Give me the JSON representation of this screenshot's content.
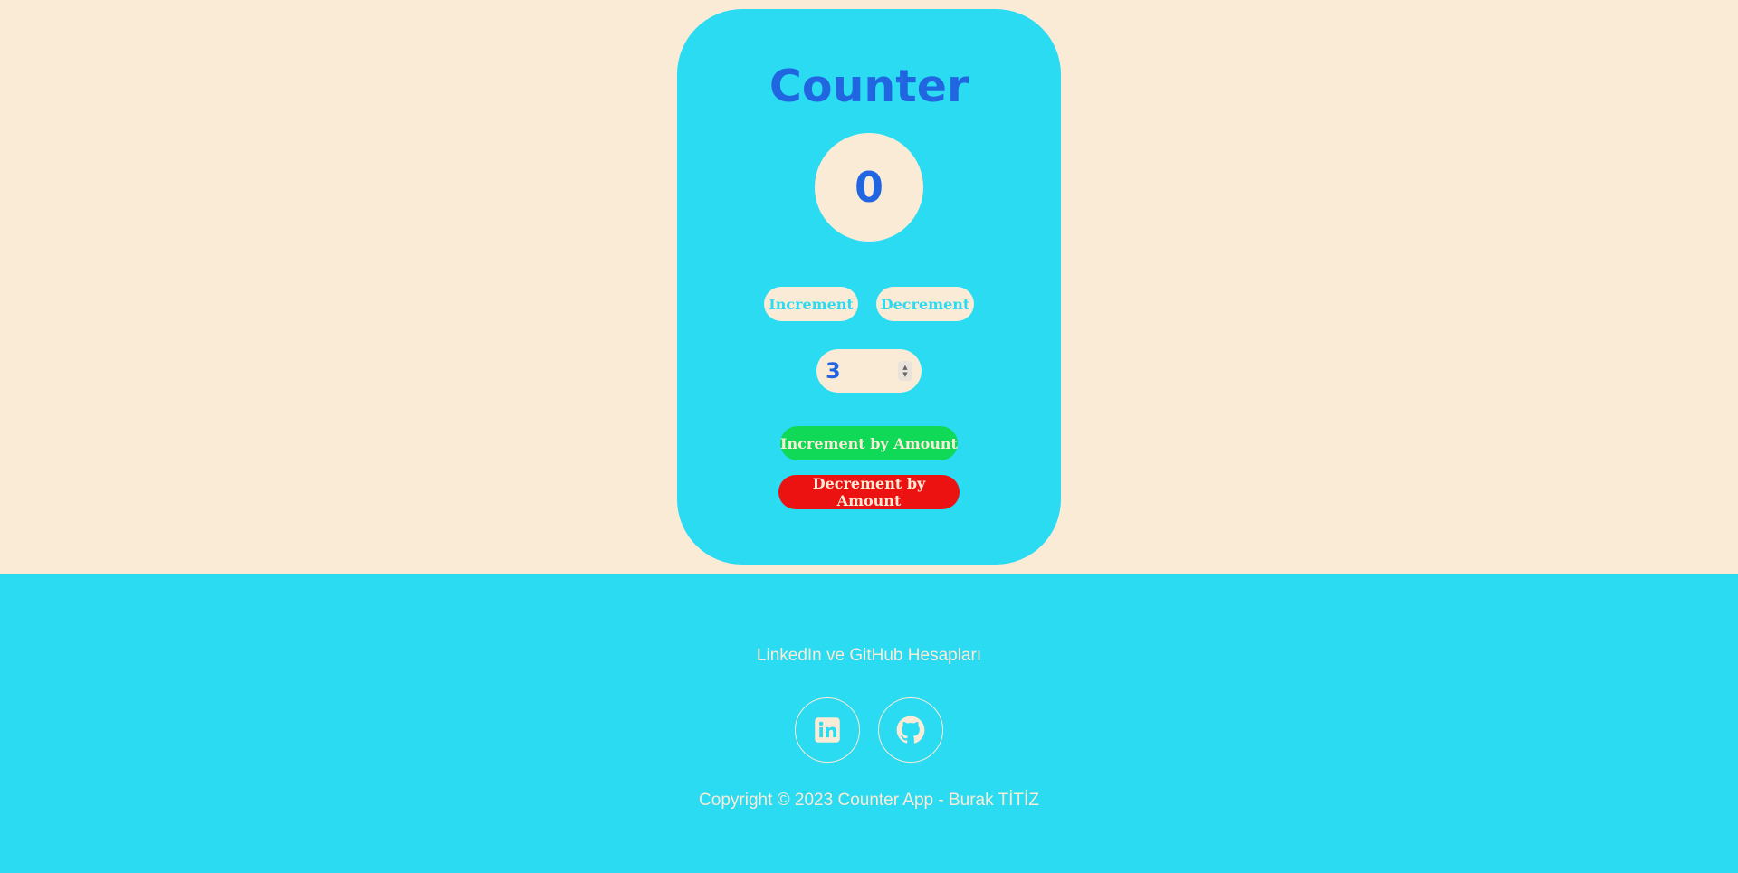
{
  "card": {
    "title": "Counter",
    "count": "0",
    "increment_label": "Increment",
    "decrement_label": "Decrement",
    "amount_value": "3",
    "increment_amount_label": "Increment by Amount",
    "decrement_amount_label": "Decrement by Amount"
  },
  "footer": {
    "heading": "LinkedIn ve GitHub Hesapları",
    "social": [
      {
        "icon": "linkedin-icon"
      },
      {
        "icon": "github-icon"
      }
    ],
    "copyright": "Copyright © 2023 Counter App - Burak TİTİZ"
  },
  "colors": {
    "background": "#faebd7",
    "accent": "#2adbf2",
    "title": "#2166e0",
    "increment_amount": "#10d958",
    "decrement_amount": "#ec1212"
  }
}
